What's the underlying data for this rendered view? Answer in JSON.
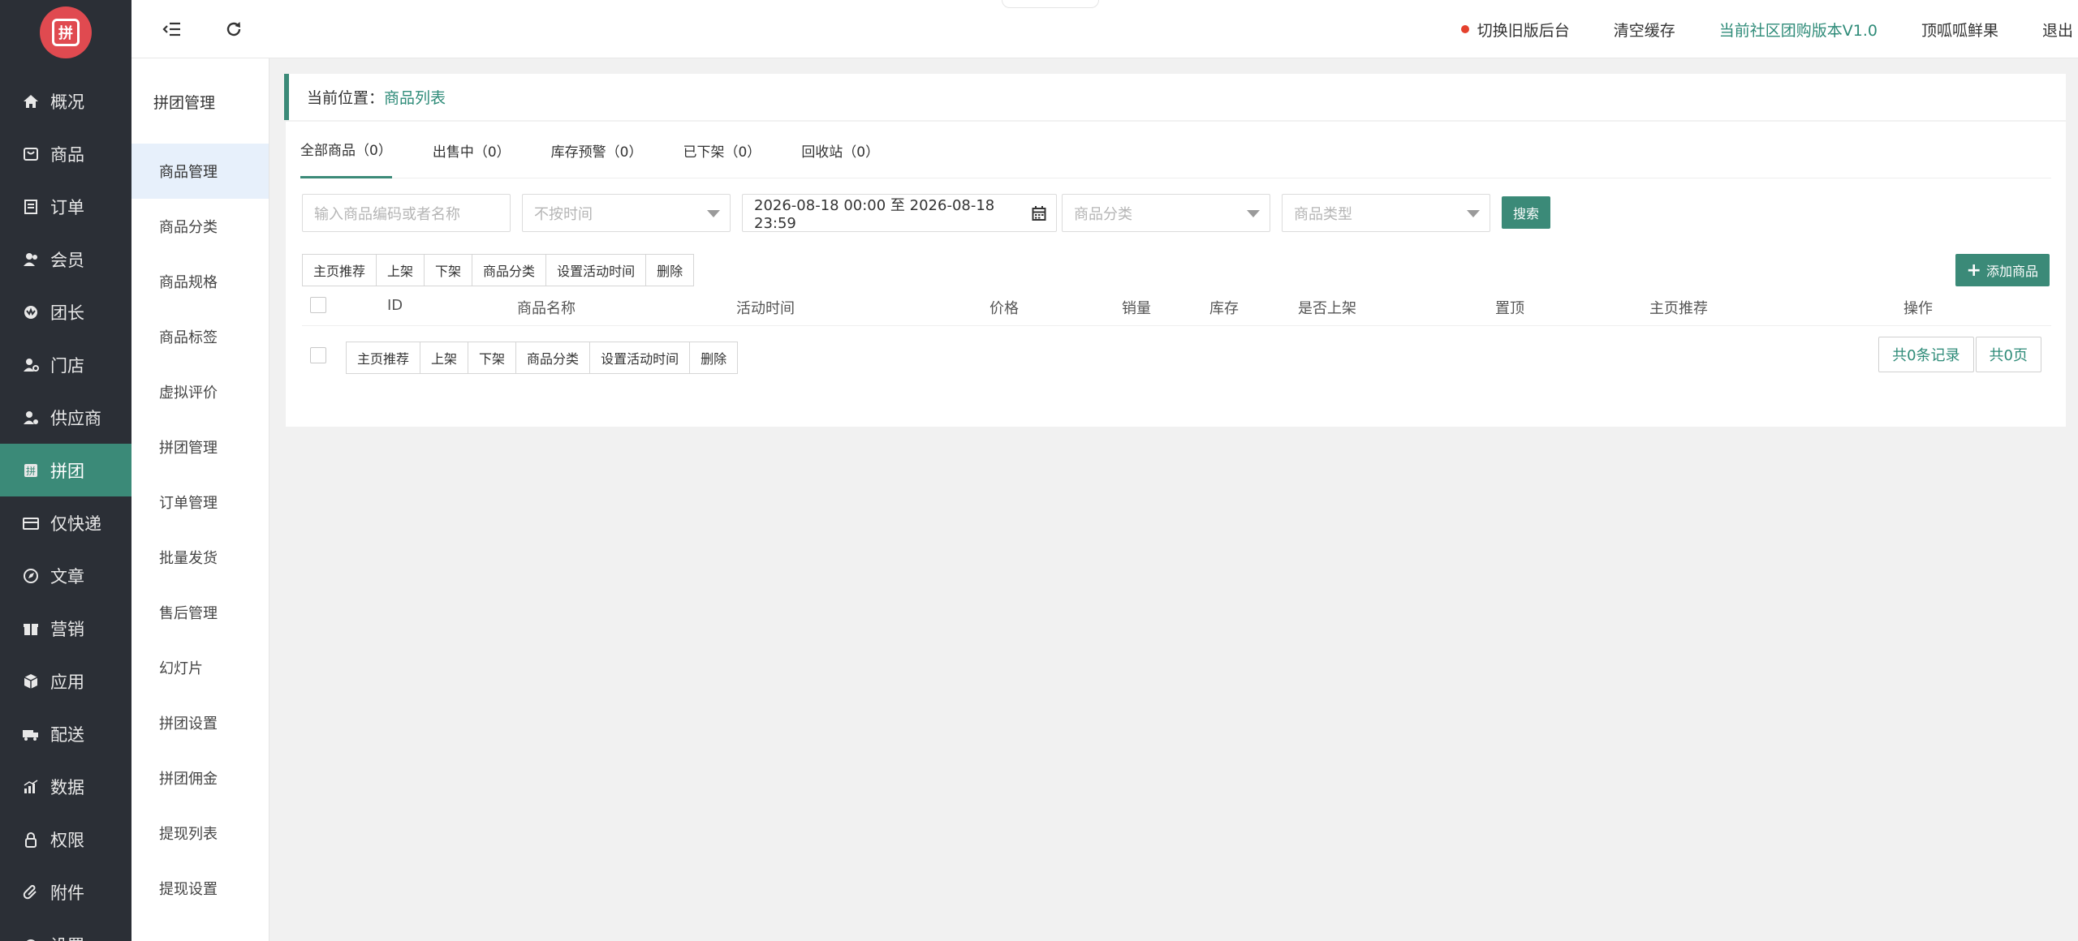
{
  "logo": {
    "glyph": "拼"
  },
  "nav": [
    {
      "label": "概况",
      "icon": "home-icon"
    },
    {
      "label": "商品",
      "icon": "goods-icon"
    },
    {
      "label": "订单",
      "icon": "order-icon"
    },
    {
      "label": "会员",
      "icon": "member-icon"
    },
    {
      "label": "团长",
      "icon": "leader-icon"
    },
    {
      "label": "门店",
      "icon": "store-icon"
    },
    {
      "label": "供应商",
      "icon": "supplier-icon"
    },
    {
      "label": "拼团",
      "icon": "group-buy-icon",
      "active": true
    },
    {
      "label": "仅快递",
      "icon": "express-icon"
    },
    {
      "label": "文章",
      "icon": "article-icon"
    },
    {
      "label": "营销",
      "icon": "gift-icon"
    },
    {
      "label": "应用",
      "icon": "app-icon"
    },
    {
      "label": "配送",
      "icon": "delivery-icon"
    },
    {
      "label": "数据",
      "icon": "data-icon"
    },
    {
      "label": "权限",
      "icon": "lock-icon"
    },
    {
      "label": "附件",
      "icon": "attachment-icon"
    },
    {
      "label": "设置",
      "icon": "settings-icon"
    }
  ],
  "submenu": {
    "title": "拼团管理",
    "items": [
      "商品管理",
      "商品分类",
      "商品规格",
      "商品标签",
      "虚拟评价",
      "拼团管理",
      "订单管理",
      "批量发货",
      "售后管理",
      "幻灯片",
      "拼团设置",
      "拼团佣金",
      "提现列表",
      "提现设置"
    ]
  },
  "topbar": {
    "switch_old": "切换旧版后台",
    "clear_cache": "清空缓存",
    "version": "当前社区团购版本V1.0",
    "user": "顶呱呱鲜果",
    "logout": "退出"
  },
  "breadcrumb": {
    "prefix": "当前位置：",
    "current": "商品列表"
  },
  "tabs": [
    "全部商品（0）",
    "出售中（0）",
    "库存预警（0）",
    "已下架（0）",
    "回收站（0）"
  ],
  "filters": {
    "keyword_placeholder": "输入商品编码或者名称",
    "time_select": "不按时间",
    "date_range": "2026-08-18 00:00 至 2026-08-18 23:59",
    "category_select": "商品分类",
    "type_select": "商品类型",
    "search": "搜索"
  },
  "actions": [
    "主页推荐",
    "上架",
    "下架",
    "商品分类",
    "设置活动时间",
    "删除"
  ],
  "add_button": "添加商品",
  "table": {
    "headers": [
      "ID",
      "商品名称",
      "活动时间",
      "价格",
      "销量",
      "库存",
      "是否上架",
      "置顶",
      "主页推荐",
      "操作"
    ]
  },
  "pager": {
    "records": "共0条记录",
    "pages": "共0页"
  },
  "colors": {
    "accent": "#3b8a78",
    "sidebar": "#2b2f36",
    "logo": "#e04a50"
  }
}
